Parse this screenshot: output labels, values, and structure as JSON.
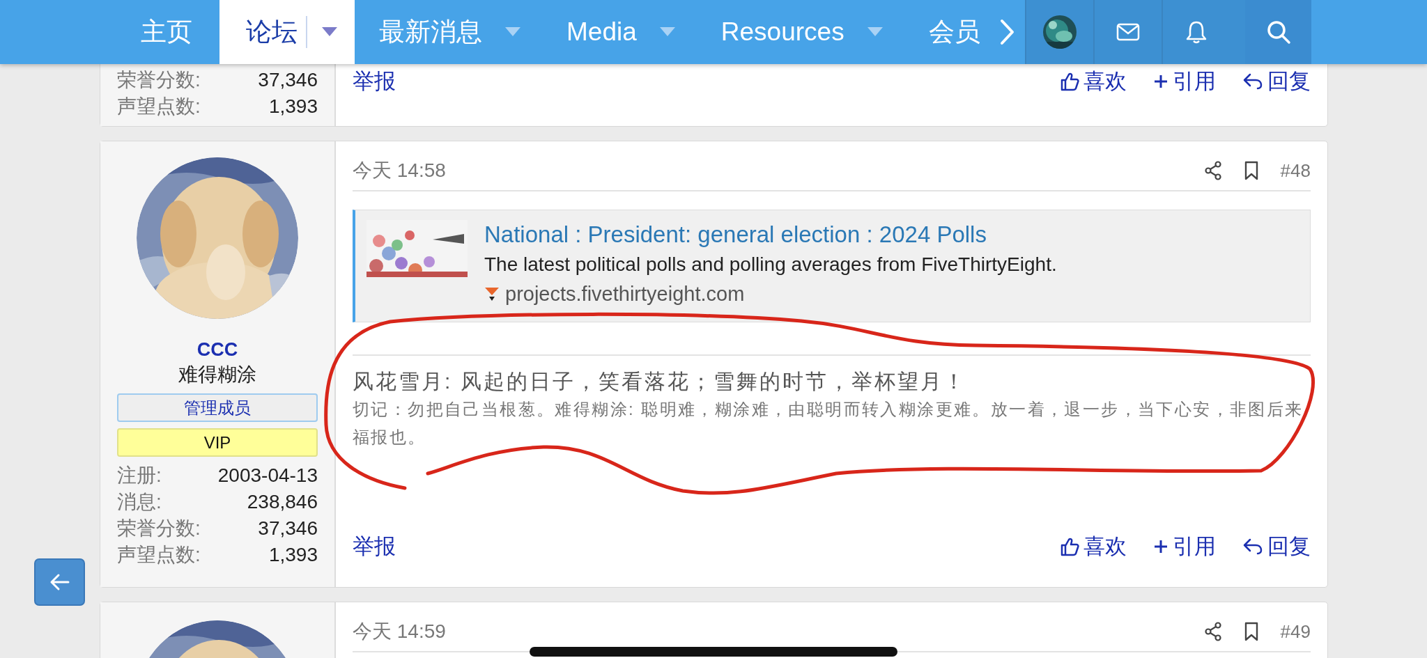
{
  "nav": {
    "items": [
      {
        "label": "主页",
        "selected": false,
        "dropdown": false
      },
      {
        "label": "论坛",
        "selected": true,
        "dropdown": true
      },
      {
        "label": "最新消息",
        "selected": false,
        "dropdown": true
      },
      {
        "label": "Media",
        "selected": false,
        "dropdown": true
      },
      {
        "label": "Resources",
        "selected": false,
        "dropdown": true
      },
      {
        "label": "会员",
        "selected": false,
        "dropdown": false
      }
    ]
  },
  "posts": [
    {
      "kind": "partial-top",
      "stats": [
        {
          "label": "荣誉分数:",
          "value": "37,346"
        },
        {
          "label": "声望点数:",
          "value": "1,393"
        }
      ],
      "report": "举报",
      "actions": [
        {
          "kind": "like",
          "label": "喜欢"
        },
        {
          "kind": "quote",
          "label": "引用"
        },
        {
          "kind": "reply",
          "label": "回复"
        }
      ]
    },
    {
      "kind": "full",
      "time": "今天 14:58",
      "number": "#48",
      "user": {
        "name": "CCC",
        "title": "难得糊涂",
        "badges": [
          {
            "kind": "staff",
            "text": "管理成员"
          },
          {
            "kind": "vip",
            "text": "VIP"
          }
        ]
      },
      "stats": [
        {
          "label": "注册:",
          "value": "2003-04-13"
        },
        {
          "label": "消息:",
          "value": "238,846"
        },
        {
          "label": "荣誉分数:",
          "value": "37,346"
        },
        {
          "label": "声望点数:",
          "value": "1,393"
        }
      ],
      "embed": {
        "title": "National : President: general election : 2024 Polls",
        "description": "The latest political polls and polling averages from FiveThirtyEight.",
        "domain": "projects.fivethirtyeight.com"
      },
      "signature": {
        "headline": "风花雪月: 风起的日子，笑看落花；雪舞的时节，举杯望月！",
        "text": "切记：勿把自己当根葱。难得糊涂: 聪明难，糊涂难，由聪明而转入糊涂更难。放一着，退一步，当下心安，非图后来福报也。"
      },
      "report": "举报",
      "actions": [
        {
          "kind": "like",
          "label": "喜欢"
        },
        {
          "kind": "quote",
          "label": "引用"
        },
        {
          "kind": "reply",
          "label": "回复"
        }
      ]
    },
    {
      "kind": "partial-bottom",
      "time": "今天 14:59",
      "number": "#49"
    }
  ]
}
